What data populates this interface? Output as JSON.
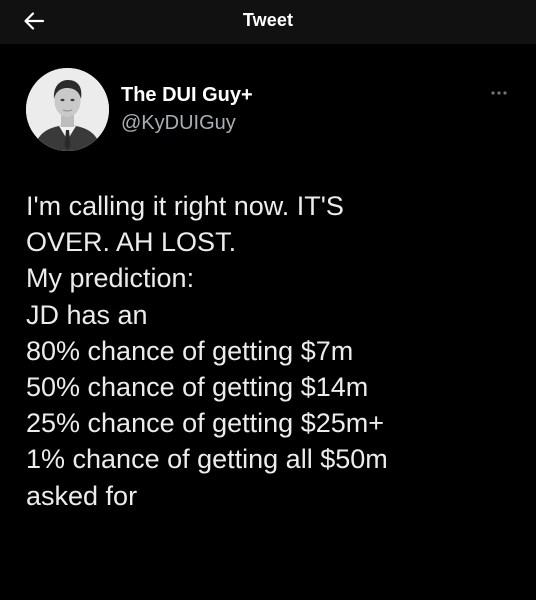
{
  "header": {
    "title": "Tweet",
    "back_icon": "arrow-left-icon"
  },
  "author": {
    "display_name": "The DUI Guy+",
    "handle": "@KyDUIGuy",
    "avatar_icon": "avatar-photo"
  },
  "menu": {
    "more_icon": "more-horizontal-icon"
  },
  "tweet": {
    "lines": [
      "I'm calling it right now. IT'S",
      "OVER. AH LOST.",
      "My prediction:",
      "JD has an",
      "80% chance of getting $7m",
      "50% chance of getting $14m",
      "25% chance of getting $25m+",
      "1% chance of getting all $50m",
      "asked for"
    ]
  },
  "colors": {
    "background": "#000000",
    "topbar": "#111111",
    "text_primary": "#ffffff",
    "text_secondary": "#a9afb4"
  }
}
